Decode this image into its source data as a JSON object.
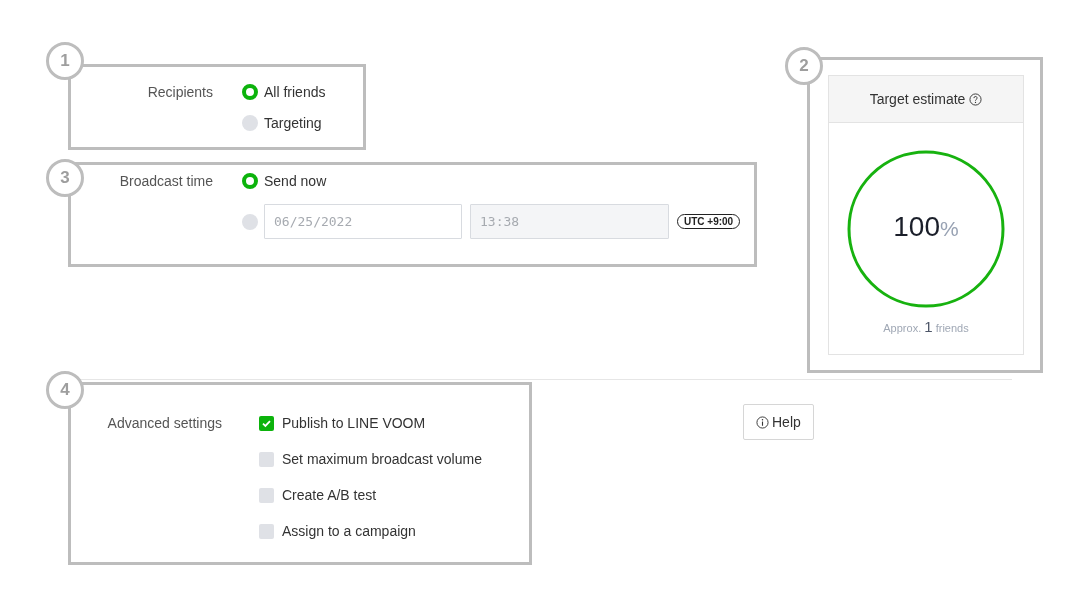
{
  "recipients": {
    "badge": "1",
    "label": "Recipients",
    "options": [
      {
        "label": "All friends",
        "selected": true
      },
      {
        "label": "Targeting",
        "selected": false
      }
    ]
  },
  "broadcast_time": {
    "badge": "3",
    "label": "Broadcast time",
    "options": [
      {
        "kind": "text",
        "label": "Send now",
        "selected": true
      },
      {
        "kind": "schedule",
        "selected": false,
        "date": "06/25/2022",
        "time": "13:38",
        "timezone": "UTC +9:00"
      }
    ]
  },
  "target_estimate": {
    "badge": "2",
    "title": "Target estimate",
    "percent": "100",
    "percent_sign": "%",
    "level": 1,
    "approx": {
      "prefix": "Approx.",
      "count": "1",
      "suffix": "friends"
    }
  },
  "advanced_settings": {
    "badge": "4",
    "label": "Advanced settings",
    "options": [
      {
        "label": "Publish to LINE VOOM",
        "checked": true
      },
      {
        "label": "Set maximum broadcast volume",
        "checked": false
      },
      {
        "label": "Create A/B test",
        "checked": false
      },
      {
        "label": "Assign to a campaign",
        "checked": false
      }
    ]
  },
  "help_button": {
    "label": "Help"
  }
}
